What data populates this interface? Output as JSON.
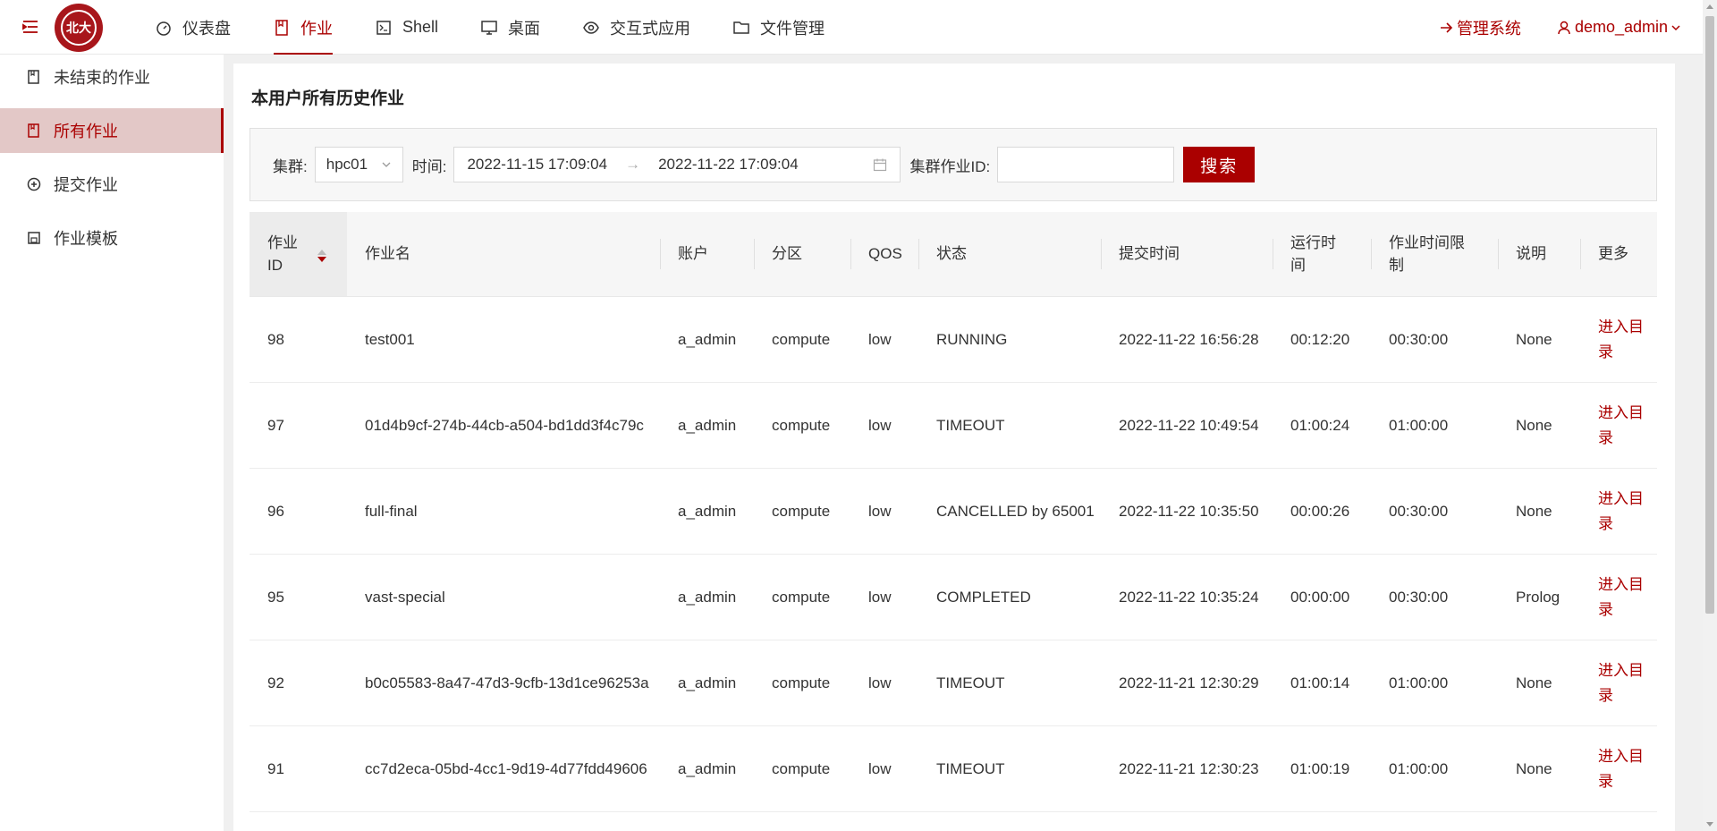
{
  "header": {
    "logo_text": "北大",
    "nav": [
      {
        "label": "仪表盘",
        "icon": "dashboard-icon"
      },
      {
        "label": "作业",
        "icon": "book-icon"
      },
      {
        "label": "Shell",
        "icon": "terminal-icon"
      },
      {
        "label": "桌面",
        "icon": "desktop-icon"
      },
      {
        "label": "交互式应用",
        "icon": "eye-icon"
      },
      {
        "label": "文件管理",
        "icon": "folder-icon"
      }
    ],
    "admin_link": "管理系统",
    "user": "demo_admin"
  },
  "sidebar": {
    "items": [
      {
        "label": "未结束的作业",
        "icon": "book-icon"
      },
      {
        "label": "所有作业",
        "icon": "book-icon"
      },
      {
        "label": "提交作业",
        "icon": "plus-circle-icon"
      },
      {
        "label": "作业模板",
        "icon": "save-icon"
      }
    ]
  },
  "main": {
    "title": "本用户所有历史作业",
    "filters": {
      "cluster_label": "集群:",
      "cluster_value": "hpc01",
      "time_label": "时间:",
      "time_start": "2022-11-15 17:09:04",
      "time_end": "2022-11-22 17:09:04",
      "job_id_label": "集群作业ID:",
      "job_id_value": "",
      "search_label": "搜索"
    },
    "table": {
      "headers": [
        "作业ID",
        "作业名",
        "账户",
        "分区",
        "QOS",
        "状态",
        "提交时间",
        "运行时间",
        "作业时间限制",
        "说明",
        "更多"
      ],
      "rows": [
        {
          "id": "98",
          "name": "test001",
          "account": "a_admin",
          "partition": "compute",
          "qos": "low",
          "state": "RUNNING",
          "submit": "2022-11-22 16:56:28",
          "elapsed": "00:12:20",
          "limit": "00:30:00",
          "reason": "None",
          "action": "进入目录"
        },
        {
          "id": "97",
          "name": "01d4b9cf-274b-44cb-a504-bd1dd3f4c79c",
          "account": "a_admin",
          "partition": "compute",
          "qos": "low",
          "state": "TIMEOUT",
          "submit": "2022-11-22 10:49:54",
          "elapsed": "01:00:24",
          "limit": "01:00:00",
          "reason": "None",
          "action": "进入目录"
        },
        {
          "id": "96",
          "name": "full-final",
          "account": "a_admin",
          "partition": "compute",
          "qos": "low",
          "state": "CANCELLED by 65001",
          "submit": "2022-11-22 10:35:50",
          "elapsed": "00:00:26",
          "limit": "00:30:00",
          "reason": "None",
          "action": "进入目录"
        },
        {
          "id": "95",
          "name": "vast-special",
          "account": "a_admin",
          "partition": "compute",
          "qos": "low",
          "state": "COMPLETED",
          "submit": "2022-11-22 10:35:24",
          "elapsed": "00:00:00",
          "limit": "00:30:00",
          "reason": "Prolog",
          "action": "进入目录"
        },
        {
          "id": "92",
          "name": "b0c05583-8a47-47d3-9cfb-13d1ce96253a",
          "account": "a_admin",
          "partition": "compute",
          "qos": "low",
          "state": "TIMEOUT",
          "submit": "2022-11-21 12:30:29",
          "elapsed": "01:00:14",
          "limit": "01:00:00",
          "reason": "None",
          "action": "进入目录"
        },
        {
          "id": "91",
          "name": "cc7d2eca-05bd-4cc1-9d19-4d77fdd49606",
          "account": "a_admin",
          "partition": "compute",
          "qos": "low",
          "state": "TIMEOUT",
          "submit": "2022-11-21 12:30:23",
          "elapsed": "01:00:19",
          "limit": "01:00:00",
          "reason": "None",
          "action": "进入目录"
        }
      ]
    }
  },
  "colors": {
    "accent": "#aa0000",
    "active_bg": "#e3c8c7"
  }
}
